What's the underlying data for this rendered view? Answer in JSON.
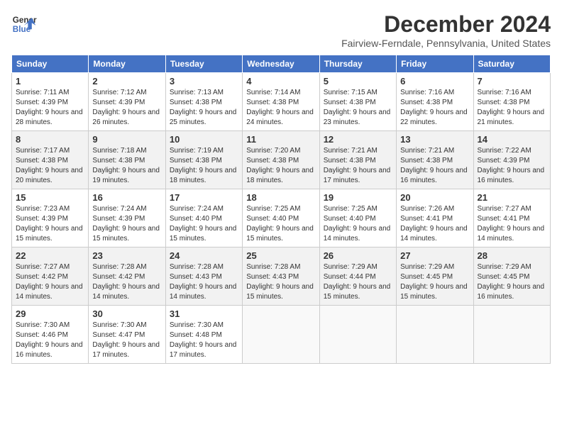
{
  "header": {
    "logo": {
      "line1": "General",
      "line2": "Blue"
    },
    "title": "December 2024",
    "location": "Fairview-Ferndale, Pennsylvania, United States"
  },
  "calendar": {
    "days_of_week": [
      "Sunday",
      "Monday",
      "Tuesday",
      "Wednesday",
      "Thursday",
      "Friday",
      "Saturday"
    ],
    "weeks": [
      [
        {
          "day": "1",
          "sunrise": "7:11 AM",
          "sunset": "4:39 PM",
          "daylight": "9 hours and 28 minutes."
        },
        {
          "day": "2",
          "sunrise": "7:12 AM",
          "sunset": "4:39 PM",
          "daylight": "9 hours and 26 minutes."
        },
        {
          "day": "3",
          "sunrise": "7:13 AM",
          "sunset": "4:38 PM",
          "daylight": "9 hours and 25 minutes."
        },
        {
          "day": "4",
          "sunrise": "7:14 AM",
          "sunset": "4:38 PM",
          "daylight": "9 hours and 24 minutes."
        },
        {
          "day": "5",
          "sunrise": "7:15 AM",
          "sunset": "4:38 PM",
          "daylight": "9 hours and 23 minutes."
        },
        {
          "day": "6",
          "sunrise": "7:16 AM",
          "sunset": "4:38 PM",
          "daylight": "9 hours and 22 minutes."
        },
        {
          "day": "7",
          "sunrise": "7:16 AM",
          "sunset": "4:38 PM",
          "daylight": "9 hours and 21 minutes."
        }
      ],
      [
        {
          "day": "8",
          "sunrise": "7:17 AM",
          "sunset": "4:38 PM",
          "daylight": "9 hours and 20 minutes."
        },
        {
          "day": "9",
          "sunrise": "7:18 AM",
          "sunset": "4:38 PM",
          "daylight": "9 hours and 19 minutes."
        },
        {
          "day": "10",
          "sunrise": "7:19 AM",
          "sunset": "4:38 PM",
          "daylight": "9 hours and 18 minutes."
        },
        {
          "day": "11",
          "sunrise": "7:20 AM",
          "sunset": "4:38 PM",
          "daylight": "9 hours and 18 minutes."
        },
        {
          "day": "12",
          "sunrise": "7:21 AM",
          "sunset": "4:38 PM",
          "daylight": "9 hours and 17 minutes."
        },
        {
          "day": "13",
          "sunrise": "7:21 AM",
          "sunset": "4:38 PM",
          "daylight": "9 hours and 16 minutes."
        },
        {
          "day": "14",
          "sunrise": "7:22 AM",
          "sunset": "4:39 PM",
          "daylight": "9 hours and 16 minutes."
        }
      ],
      [
        {
          "day": "15",
          "sunrise": "7:23 AM",
          "sunset": "4:39 PM",
          "daylight": "9 hours and 15 minutes."
        },
        {
          "day": "16",
          "sunrise": "7:24 AM",
          "sunset": "4:39 PM",
          "daylight": "9 hours and 15 minutes."
        },
        {
          "day": "17",
          "sunrise": "7:24 AM",
          "sunset": "4:40 PM",
          "daylight": "9 hours and 15 minutes."
        },
        {
          "day": "18",
          "sunrise": "7:25 AM",
          "sunset": "4:40 PM",
          "daylight": "9 hours and 15 minutes."
        },
        {
          "day": "19",
          "sunrise": "7:25 AM",
          "sunset": "4:40 PM",
          "daylight": "9 hours and 14 minutes."
        },
        {
          "day": "20",
          "sunrise": "7:26 AM",
          "sunset": "4:41 PM",
          "daylight": "9 hours and 14 minutes."
        },
        {
          "day": "21",
          "sunrise": "7:27 AM",
          "sunset": "4:41 PM",
          "daylight": "9 hours and 14 minutes."
        }
      ],
      [
        {
          "day": "22",
          "sunrise": "7:27 AM",
          "sunset": "4:42 PM",
          "daylight": "9 hours and 14 minutes."
        },
        {
          "day": "23",
          "sunrise": "7:28 AM",
          "sunset": "4:42 PM",
          "daylight": "9 hours and 14 minutes."
        },
        {
          "day": "24",
          "sunrise": "7:28 AM",
          "sunset": "4:43 PM",
          "daylight": "9 hours and 14 minutes."
        },
        {
          "day": "25",
          "sunrise": "7:28 AM",
          "sunset": "4:43 PM",
          "daylight": "9 hours and 15 minutes."
        },
        {
          "day": "26",
          "sunrise": "7:29 AM",
          "sunset": "4:44 PM",
          "daylight": "9 hours and 15 minutes."
        },
        {
          "day": "27",
          "sunrise": "7:29 AM",
          "sunset": "4:45 PM",
          "daylight": "9 hours and 15 minutes."
        },
        {
          "day": "28",
          "sunrise": "7:29 AM",
          "sunset": "4:45 PM",
          "daylight": "9 hours and 16 minutes."
        }
      ],
      [
        {
          "day": "29",
          "sunrise": "7:30 AM",
          "sunset": "4:46 PM",
          "daylight": "9 hours and 16 minutes."
        },
        {
          "day": "30",
          "sunrise": "7:30 AM",
          "sunset": "4:47 PM",
          "daylight": "9 hours and 17 minutes."
        },
        {
          "day": "31",
          "sunrise": "7:30 AM",
          "sunset": "4:48 PM",
          "daylight": "9 hours and 17 minutes."
        },
        null,
        null,
        null,
        null
      ]
    ]
  }
}
